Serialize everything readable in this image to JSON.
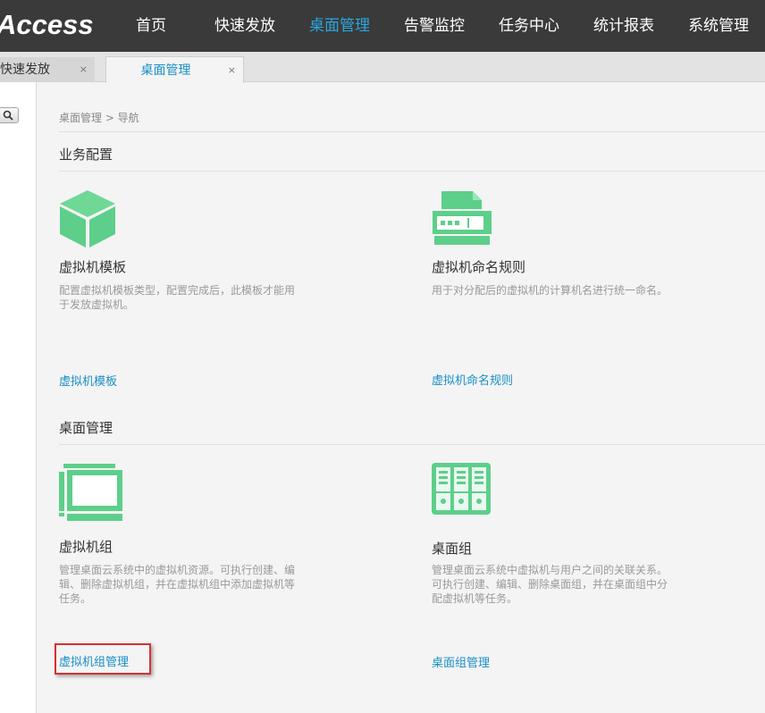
{
  "app": {
    "logo_text": "Access"
  },
  "nav": {
    "items": [
      {
        "label": "首页"
      },
      {
        "label": "快速发放"
      },
      {
        "label": "桌面管理",
        "active": true
      },
      {
        "label": "告警监控"
      },
      {
        "label": "任务中心"
      },
      {
        "label": "统计报表"
      },
      {
        "label": "系统管理"
      }
    ]
  },
  "tabs": [
    {
      "label": "快速发放",
      "close": "×"
    },
    {
      "label": "桌面管理",
      "close": "×",
      "active": true
    }
  ],
  "breadcrumb": "桌面管理 > 导航",
  "sections": [
    {
      "title": "业务配置",
      "cards": [
        {
          "icon": "cube-icon",
          "title": "虚拟机模板",
          "desc": "配置虚拟机模板类型，配置完成后，此模板才能用于发放虚拟机。",
          "link": "虚拟机模板"
        },
        {
          "icon": "printer-icon",
          "title": "虚拟机命名规则",
          "desc": "用于对分配后的虚拟机的计算机名进行统一命名。",
          "link": "虚拟机命名规则"
        }
      ]
    },
    {
      "title": "桌面管理",
      "cards": [
        {
          "icon": "monitor-stack-icon",
          "title": "虚拟机组",
          "desc": "管理桌面云系统中的虚拟机资源。可执行创建、编辑、删除虚拟机组，并在虚拟机组中添加虚拟机等任务。",
          "link": "虚拟机组管理"
        },
        {
          "icon": "desktop-group-icon",
          "title": "桌面组",
          "desc": "管理桌面云系统中虚拟机与用户之间的关联关系。可执行创建、编辑、删除桌面组，并在桌面组中分配虚拟机等任务。",
          "link": "桌面组管理"
        }
      ]
    }
  ],
  "colors": {
    "accent": "#2ba6de",
    "link": "#1a8fc6",
    "icon_green": "#5dcf8a",
    "highlight": "#d83030"
  },
  "sidebar": {
    "search_icon": "search-icon"
  }
}
